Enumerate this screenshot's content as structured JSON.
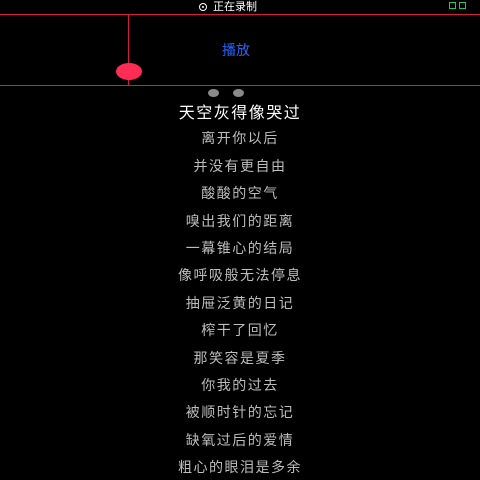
{
  "status_bar": {
    "recording_text": "正在录制",
    "recording_icon": "record-eye-icon"
  },
  "recorder": {
    "play_label": "播放",
    "accent_color": "#d81b43",
    "knob_color": "#ff2d55",
    "play_label_color": "#2563ff"
  },
  "pager": {
    "page_count": 2
  },
  "lyrics": {
    "lines": [
      "天空灰得像哭过",
      "离开你以后",
      "并没有更自由",
      "酸酸的空气",
      "嗅出我们的距离",
      "一幕锥心的结局",
      "像呼吸般无法停息",
      "抽屉泛黄的日记",
      "榨干了回忆",
      "那笑容是夏季",
      "你我的过去",
      "被顺时针的忘记",
      "缺氧过后的爱情",
      "粗心的眼泪是多余"
    ],
    "current_index": 0
  }
}
